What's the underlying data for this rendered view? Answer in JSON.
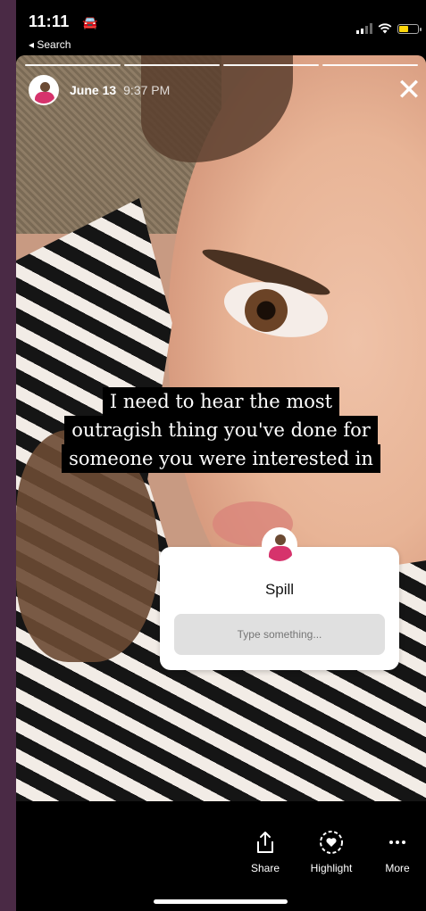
{
  "status": {
    "time": "11:11",
    "back_label": "◂ Search"
  },
  "story": {
    "date": "June 13",
    "time": "9:37 PM",
    "caption_lines": [
      "I need to hear the most",
      "outragish thing you've done for",
      "someone you were interested in"
    ]
  },
  "question_sticker": {
    "title": "Spill",
    "placeholder": "Type something..."
  },
  "actions": {
    "share": "Share",
    "highlight": "Highlight",
    "more": "More"
  },
  "colors": {
    "battery": "#ffd60a",
    "background": "#4a2a45",
    "avatar_shirt": "#d6336c"
  }
}
